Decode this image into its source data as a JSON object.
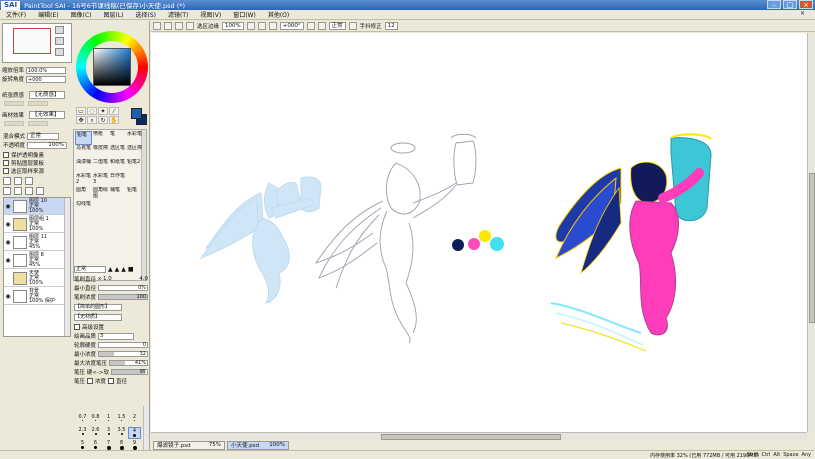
{
  "window": {
    "logo": "SAI",
    "title": "PaintTool SAI  - 16号6节课线稿(已保存)小天使.psd (*)"
  },
  "menu": [
    "文件(F)",
    "编辑(E)",
    "图像(C)",
    "图层(L)",
    "选择(S)",
    "滤镜(T)",
    "视图(V)",
    "窗口(W)",
    "其他(O)"
  ],
  "navigator": {
    "zoom_label": "缩放倍率",
    "zoom_value": "100.0%",
    "rotate_label": "旋转角度",
    "rotate_value": "+000"
  },
  "layer_options": {
    "texture_label": "纸张质感",
    "texture_value": "【无质感】",
    "effect_label": "画材效果",
    "effect_value": "【无效果】",
    "blend_label": "混合模式",
    "blend_value": "正常",
    "opacity_label": "不透明度",
    "opacity_value": "100%",
    "check1": "保护透明像素",
    "check2": "剪贴图层蒙板",
    "check3": "选区取样来源"
  },
  "layers": [
    {
      "name": "图层 10",
      "mode": "正常",
      "opacity": "100%",
      "selected": true,
      "folder": false
    },
    {
      "name": "图层组 1",
      "mode": "正常",
      "opacity": "100%",
      "selected": false,
      "folder": true
    },
    {
      "name": "图层 11",
      "mode": "正常",
      "opacity": "45%",
      "selected": false,
      "folder": false
    },
    {
      "name": "图层 8",
      "mode": "正常",
      "opacity": "45%",
      "selected": false,
      "folder": false
    },
    {
      "name": "天使",
      "mode": "正常",
      "opacity": "100%",
      "selected": false,
      "folder": true
    },
    {
      "name": "背景",
      "mode": "正常",
      "opacity": "100%",
      "extra": "保护",
      "selected": false,
      "folder": false
    }
  ],
  "brushes": [
    {
      "label": "铅笔",
      "active": true
    },
    {
      "label": "喷枪",
      "active": false
    },
    {
      "label": "笔",
      "active": false
    },
    {
      "label": "水彩笔",
      "active": false
    },
    {
      "label": "马克笔",
      "active": false
    },
    {
      "label": "橡皮擦",
      "active": false
    },
    {
      "label": "选区笔",
      "active": false
    },
    {
      "label": "选区擦",
      "active": false
    },
    {
      "label": "油漆桶",
      "active": false
    },
    {
      "label": "二值笔",
      "active": false
    },
    {
      "label": "和纸笔",
      "active": false
    },
    {
      "label": "铅笔2",
      "active": false
    },
    {
      "label": "水彩笔2",
      "active": false
    },
    {
      "label": "水彩笔3",
      "active": false
    },
    {
      "label": "日作笔",
      "active": false
    },
    {
      "label": "",
      "active": false
    },
    {
      "label": "圆角",
      "active": false
    },
    {
      "label": "圆角绘图",
      "active": false
    },
    {
      "label": "铺笔",
      "active": false
    },
    {
      "label": "铅笔",
      "active": false
    },
    {
      "label": "勾线笔",
      "active": false
    }
  ],
  "brush_props": {
    "mode": "正常",
    "size_label": "笔刷直径",
    "size_mult": "x 1.0",
    "size_value": "4.0",
    "min_size_label": "最小直径",
    "min_size_value": "0%",
    "density_label": "笔刷浓度",
    "density_value": "100",
    "shape_value": "【简单的圆形】",
    "texture_value": "【无材质】",
    "advanced_label": "高级设置",
    "quality_label": "绘画品质",
    "quality_value": "3",
    "edge_label": "轮廓硬度",
    "edge_value": "0",
    "min_density_label": "最小浓度",
    "min_density_value": "32",
    "max_pressure_label": "最大浓度笔压",
    "max_pressure_value": "41%",
    "pressure_hard_label": "笔压 硬<->软",
    "pressure_hard_value": "95",
    "pressure_label": "笔压",
    "pressure_density": "浓度",
    "pressure_size": "直径"
  },
  "brush_sizes": [
    {
      "label": "0.7",
      "d": 1,
      "active": false
    },
    {
      "label": "0.8",
      "d": 1,
      "active": false
    },
    {
      "label": "1",
      "d": 1,
      "active": false
    },
    {
      "label": "1.5",
      "d": 1,
      "active": false
    },
    {
      "label": "2",
      "d": 1,
      "active": false
    },
    {
      "label": "2.3",
      "d": 2,
      "active": false
    },
    {
      "label": "2.6",
      "d": 2,
      "active": false
    },
    {
      "label": "3",
      "d": 2,
      "active": false
    },
    {
      "label": "3.5",
      "d": 2,
      "active": false
    },
    {
      "label": "4",
      "d": 3,
      "active": true
    },
    {
      "label": "5",
      "d": 3,
      "active": false
    },
    {
      "label": "6",
      "d": 3,
      "active": false
    },
    {
      "label": "7",
      "d": 4,
      "active": false
    },
    {
      "label": "8",
      "d": 4,
      "active": false
    },
    {
      "label": "9",
      "d": 4,
      "active": false
    },
    {
      "label": "10",
      "d": 5,
      "active": false
    },
    {
      "label": "12",
      "d": 5,
      "active": false
    },
    {
      "label": "14",
      "d": 6,
      "active": false
    },
    {
      "label": "16",
      "d": 6,
      "active": false
    },
    {
      "label": "20",
      "d": 7,
      "active": false
    }
  ],
  "toolbar": {
    "antialias_label": "选区边缘",
    "zoom_value": "100%",
    "rotate_value": "+000°",
    "mode_value": "正常",
    "stabilizer_label": "手抖修正",
    "stabilizer_value": "12"
  },
  "documents": [
    {
      "name": "爆滤镜子.psd",
      "zoom": "75%",
      "active": false
    },
    {
      "name": "小天使.psd",
      "zoom": "100%",
      "active": true
    }
  ],
  "status": {
    "memory": "内存使用率 32% (已用 772MB / 可用 2198MB)",
    "indicators": [
      "Shift",
      "Ctrl",
      "Alt",
      "Space",
      "Any"
    ]
  },
  "colors": {
    "foreground": "#1c5fb0",
    "background": "#0b2a66",
    "palette_dots": [
      "#0f1e55",
      "#ff4db8",
      "#ffe800",
      "#40e0f0"
    ]
  }
}
